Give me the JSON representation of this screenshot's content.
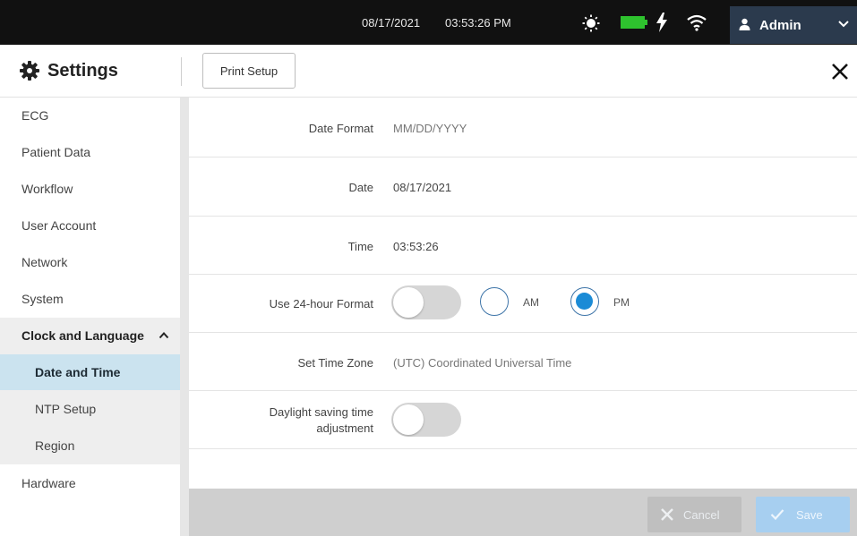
{
  "topbar": {
    "date": "08/17/2021",
    "time": "03:53:26 PM",
    "user_label": "Admin",
    "icons": [
      "sun-icon",
      "battery-icon",
      "charging-bolt-icon",
      "wifi-icon",
      "user-icon",
      "chevron-down-icon"
    ],
    "battery_color": "#2ec22e"
  },
  "header": {
    "title": "Settings",
    "print_setup_label": "Print Setup"
  },
  "sidebar": {
    "items": [
      {
        "label": "ECG"
      },
      {
        "label": "Patient Data"
      },
      {
        "label": "Workflow"
      },
      {
        "label": "User Account"
      },
      {
        "label": "Network"
      },
      {
        "label": "System"
      },
      {
        "label": "Clock and Language",
        "expanded": true
      },
      {
        "label": "Date and Time",
        "selected": true
      },
      {
        "label": "NTP Setup"
      },
      {
        "label": "Region"
      },
      {
        "label": "Hardware"
      }
    ]
  },
  "form": {
    "date_format_label": "Date Format",
    "date_format_value": "MM/DD/YYYY",
    "date_label": "Date",
    "date_value": "08/17/2021",
    "time_label": "Time",
    "time_value": "03:53:26",
    "format24_label": "Use 24-hour Format",
    "format24_on": false,
    "am_label": "AM",
    "pm_label": "PM",
    "selected_period": "PM",
    "timezone_label": "Set Time Zone",
    "timezone_value": "(UTC) Coordinated Universal Time",
    "dst_label_line1": "Daylight saving time",
    "dst_label_line2": "adjustment",
    "dst_on": false
  },
  "footer": {
    "cancel_label": "Cancel",
    "save_label": "Save"
  },
  "colors": {
    "topbar_bg": "#111111",
    "user_bg": "#2b3a4d",
    "selected_nav_bg": "#cbe3ef",
    "radio_selected": "#1b8bd6",
    "save_disabled": "#a7cff0"
  }
}
